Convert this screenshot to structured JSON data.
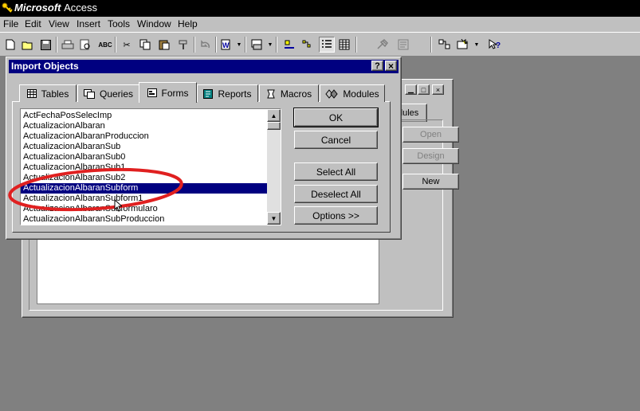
{
  "app": {
    "title_brand": "Microsoft",
    "title_rest": "Access"
  },
  "menu": [
    "File",
    "Edit",
    "View",
    "Insert",
    "Tools",
    "Window",
    "Help"
  ],
  "db_window": {
    "tab_label": "dules",
    "buttons": [
      "Open",
      "Design",
      "New"
    ]
  },
  "dialog": {
    "title": "Import Objects",
    "help": "?",
    "close": "×",
    "tabs": [
      "Tables",
      "Queries",
      "Forms",
      "Reports",
      "Macros",
      "Modules"
    ],
    "active_tab": "Forms",
    "items": [
      "ActFechaPosSelecImp",
      "ActualizacionAlbaran",
      "ActualizacionAlbaranProduccion",
      "ActualizacionAlbaranSub",
      "ActualizacionAlbaranSub0",
      "ActualizacionAlbaranSub1",
      "ActualizacionAlbaranSub2",
      "ActualizacionAlbaranSubform",
      "ActualizacionAlbaranSubform1",
      "ActualizacionAlbaranSubformularo",
      "ActualizacionAlbaranSubProduccion"
    ],
    "selected_item": "ActualizacionAlbaranSubform",
    "buttons": {
      "ok": "OK",
      "cancel": "Cancel",
      "select_all": "Select All",
      "deselect_all": "Deselect All",
      "options": "Options >>"
    }
  },
  "colors": {
    "titlebar_active": "#000080",
    "selection": "#000080",
    "annotation": "#e02020"
  }
}
